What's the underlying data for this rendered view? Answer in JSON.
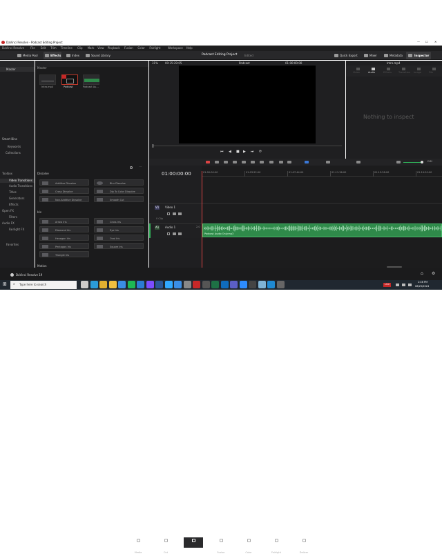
{
  "window": {
    "title": "DaVinci Resolve - Podcast Editing Project"
  },
  "menu": [
    "DaVinci Resolve",
    "File",
    "Edit",
    "Trim",
    "Timeline",
    "Clip",
    "Mark",
    "View",
    "Playback",
    "Fusion",
    "Color",
    "Fairlight",
    "Workspace",
    "Help"
  ],
  "toolbar": {
    "media_pool": "Media Pool",
    "effects": "Effects",
    "index": "Index",
    "sound_library": "Sound Library",
    "project_title": "Podcast Editing Project",
    "edited": "Edited",
    "quick_export": "Quick Export",
    "mixer": "Mixer",
    "metadata": "Metadata",
    "inspector": "Inspector"
  },
  "media": {
    "bin_header": "Master",
    "panel_header": "Master",
    "clips": [
      {
        "name": "Intro.mp4"
      },
      {
        "name": "Podcast"
      },
      {
        "name": "Podcast Au..."
      }
    ],
    "smart_bins": "Smart Bins",
    "keywords": "Keywords",
    "collections": "Collections"
  },
  "viewer": {
    "zoom": "31%",
    "duration": "00:35:29:05",
    "clip": "Podcast",
    "timecode": "01:00:00:00"
  },
  "inspector": {
    "file": "Intro.mp4",
    "tabs": [
      "Video",
      "Audio",
      "Effects",
      "Transition",
      "Image",
      "File"
    ],
    "empty": "Nothing to inspect"
  },
  "effects": {
    "tree": [
      "Toolbox",
      "Video Transitions",
      "Audio Transitions",
      "Titles",
      "Generators",
      "Effects",
      "Open FX",
      "Filters",
      "Audio FX",
      "Fairlight FX",
      "Favorites"
    ],
    "dissolve_header": "Dissolve",
    "iris_header": "Iris",
    "motion_header": "Motion",
    "dissolve": [
      "Additive Dissolve",
      "Blur Dissolve",
      "Cross Dissolve",
      "Dip To Color Dissolve",
      "Non-Additive Dissolve",
      "Smooth Cut"
    ],
    "iris": [
      "Arrow Iris",
      "Cross Iris",
      "Diamond Iris",
      "Eye Iris",
      "Hexagon Iris",
      "Oval Iris",
      "Pentagon Iris",
      "Square Iris",
      "Triangle Iris"
    ]
  },
  "timeline": {
    "timecode": "01:00:00:00",
    "ruler": [
      "01:00:00:00",
      "01:03:52:00",
      "01:07:44:00",
      "01:11:36:00",
      "01:15:28:00",
      "01:19:20:00"
    ],
    "video_track_label": "V1",
    "video_track_name": "Video 1",
    "video_clip_count": "0 Clip",
    "audio_track_label": "A1",
    "audio_track_name": "Audio 1",
    "audio_channel": "2.0",
    "audio_clip_name": "Podcast Audio Only.mp3",
    "zoom_label": "DIM"
  },
  "pages": [
    "Media",
    "Cut",
    "Edit",
    "Fusion",
    "Color",
    "Fairlight",
    "Deliver"
  ],
  "app_name": "DaVinci Resolve 19",
  "taskbar": {
    "search_placeholder": "Type here to search",
    "recording": "Live",
    "time": "2:46 PM",
    "date": "08/25/2024"
  }
}
